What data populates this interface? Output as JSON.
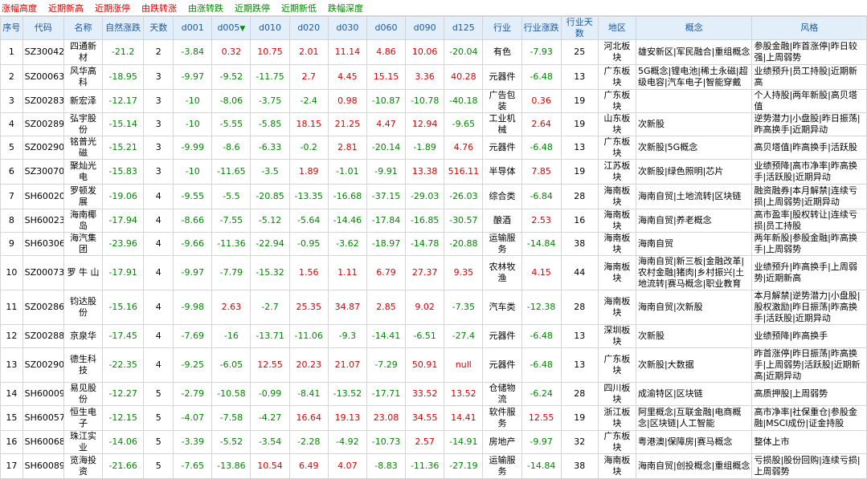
{
  "tabs": [
    {
      "label": "涨幅高度",
      "color": "red"
    },
    {
      "label": "近期新高",
      "color": "red"
    },
    {
      "label": "近期涨停",
      "color": "red"
    },
    {
      "label": "由跌转涨",
      "color": "red"
    },
    {
      "label": "由涨转跌",
      "color": "green"
    },
    {
      "label": "近期跌停",
      "color": "green"
    },
    {
      "label": "近期新低",
      "color": "green"
    },
    {
      "label": "跌幅深度",
      "color": "green"
    }
  ],
  "columns": [
    "序号",
    "代码",
    "名称",
    "自然涨跌",
    "天数",
    "d001",
    "d005",
    "d010",
    "d020",
    "d030",
    "d060",
    "d090",
    "d125",
    "行业",
    "行业涨跌",
    "行业天数",
    "地区",
    "概念",
    "风格"
  ],
  "sort_icon": "down-arrow-icon",
  "rows": [
    [
      "1",
      "SZ300428",
      "四通新材",
      "-21.2",
      "2",
      "-3.84",
      "0.32",
      "10.75",
      "2.01",
      "11.14",
      "4.86",
      "10.06",
      "-20.04",
      "有色",
      "-7.93",
      "25",
      "河北板块",
      "雄安新区|军民融合|重组概念",
      "参股金融|昨首涨停|昨日较强|上周弱势"
    ],
    [
      "2",
      "SZ000636",
      "风华高科",
      "-18.95",
      "3",
      "-9.97",
      "-9.52",
      "-11.75",
      "2.7",
      "4.45",
      "15.15",
      "3.36",
      "40.28",
      "元器件",
      "-6.48",
      "13",
      "广东板块",
      "5G概念|锂电池|稀土永磁|超级电容|汽车电子|智能穿戴",
      "业绩预升|员工持股|近期新高"
    ],
    [
      "3",
      "SZ002836",
      "新宏泽",
      "-12.17",
      "3",
      "-10",
      "-8.06",
      "-3.75",
      "-2.4",
      "0.98",
      "-10.87",
      "-10.78",
      "-40.18",
      "广告包装",
      "0.36",
      "19",
      "广东板块",
      "",
      "个人持股|两年新股|高贝塔值"
    ],
    [
      "4",
      "SZ002890",
      "弘宇股份",
      "-15.14",
      "3",
      "-10",
      "-5.55",
      "-5.85",
      "18.15",
      "21.25",
      "4.47",
      "12.94",
      "-9.65",
      "工业机械",
      "2.64",
      "19",
      "山东板块",
      "次新股",
      "逆势潜力|小盘股|昨日振荡|昨高换手|近期异动"
    ],
    [
      "5",
      "SZ002902",
      "铭普光磁",
      "-15.21",
      "3",
      "-9.99",
      "-8.6",
      "-6.33",
      "-0.2",
      "2.81",
      "-20.14",
      "-1.89",
      "4.76",
      "元器件",
      "-6.48",
      "13",
      "广东板块",
      "次新股|5G概念",
      "高贝塔值|昨高换手|活跃股"
    ],
    [
      "6",
      "SZ300708",
      "聚灿光电",
      "-15.83",
      "3",
      "-10",
      "-11.65",
      "-3.5",
      "1.89",
      "-1.01",
      "-9.91",
      "13.38",
      "516.11",
      "半导体",
      "7.85",
      "19",
      "江苏板块",
      "次新股|绿色照明|芯片",
      "业绩预降|高市净率|昨高换手|活跃股|近期异动"
    ],
    [
      "7",
      "SH600209",
      "罗顿发展",
      "-19.06",
      "4",
      "-9.55",
      "-5.5",
      "-20.85",
      "-13.35",
      "-16.68",
      "-37.15",
      "-29.03",
      "-26.03",
      "综合类",
      "-6.84",
      "28",
      "海南板块",
      "海南自贸|土地流转|区块链",
      "融资融券|本月解禁|连续亏损|上周弱势|近期异动"
    ],
    [
      "8",
      "SH600238",
      "海南椰岛",
      "-17.94",
      "4",
      "-8.66",
      "-7.55",
      "-5.12",
      "-5.64",
      "-14.46",
      "-17.84",
      "-16.85",
      "-30.57",
      "酿酒",
      "2.53",
      "16",
      "海南板块",
      "海南自贸|养老概念",
      "高市盈率|股权转让|连续亏损|员工持股"
    ],
    [
      "9",
      "SH603069",
      "海汽集团",
      "-23.96",
      "4",
      "-9.66",
      "-11.36",
      "-22.94",
      "-0.95",
      "-3.62",
      "-18.97",
      "-14.78",
      "-20.88",
      "运输服务",
      "-14.84",
      "38",
      "海南板块",
      "海南自贸",
      "两年新股|参股金融|昨高换手|上周弱势"
    ],
    [
      "10",
      "SZ000735",
      "罗 牛 山",
      "-17.91",
      "4",
      "-9.97",
      "-7.79",
      "-15.32",
      "1.56",
      "1.11",
      "6.79",
      "27.37",
      "9.35",
      "农林牧渔",
      "4.15",
      "44",
      "海南板块",
      "海南自贸|新三板|金融改革|农村金融|猪肉|乡村振兴|土地流转|赛马概念|职业教育",
      "业绩预升|昨高换手|上周弱势|近期新高"
    ],
    [
      "11",
      "SZ002865",
      "钧达股份",
      "-15.16",
      "4",
      "-9.98",
      "2.63",
      "-2.7",
      "25.35",
      "34.87",
      "2.85",
      "9.02",
      "-7.35",
      "汽车类",
      "-12.38",
      "28",
      "海南板块",
      "海南自贸|次新股",
      "本月解禁|逆势潜力|小盘股|股权激励|昨日振荡|昨高换手|活跃股|近期异动"
    ],
    [
      "12",
      "SZ002885",
      "京泉华",
      "-17.45",
      "4",
      "-7.69",
      "-16",
      "-13.71",
      "-11.06",
      "-9.3",
      "-14.41",
      "-6.51",
      "-27.4",
      "元器件",
      "-6.48",
      "13",
      "深圳板块",
      "次新股",
      "业绩预降|昨高换手"
    ],
    [
      "13",
      "SZ002908",
      "德生科技",
      "-22.35",
      "4",
      "-9.25",
      "-6.05",
      "12.55",
      "20.23",
      "21.07",
      "-7.29",
      "50.91",
      "null",
      "元器件",
      "-6.48",
      "13",
      "广东板块",
      "次新股|大数据",
      "昨首涨停|昨日振荡|昨高换手|上周弱势|活跃股|近期新高|近期异动"
    ],
    [
      "14",
      "SH600093",
      "易见股份",
      "-12.27",
      "5",
      "-2.79",
      "-10.58",
      "-0.99",
      "-8.41",
      "-13.52",
      "-17.71",
      "33.52",
      "13.52",
      "仓储物流",
      "-6.24",
      "28",
      "四川板块",
      "成渝特区|区块链",
      "高质押股|上周弱势"
    ],
    [
      "15",
      "SH600570",
      "恒生电子",
      "-12.15",
      "5",
      "-4.07",
      "-7.58",
      "-4.27",
      "16.64",
      "19.13",
      "23.08",
      "34.55",
      "14.41",
      "软件服务",
      "12.55",
      "19",
      "浙江板块",
      "阿里概念|互联金融|电商概念|区块链|人工智能",
      "高市净率|社保重仓|参股金融|MSCI成份|证金持股"
    ],
    [
      "16",
      "SH600684",
      "珠江实业",
      "-14.06",
      "5",
      "-3.39",
      "-5.52",
      "-3.54",
      "-2.28",
      "-4.92",
      "-10.73",
      "2.57",
      "-14.91",
      "房地产",
      "-9.97",
      "32",
      "广东板块",
      "粤港澳|保障房|赛马概念",
      "整体上市"
    ],
    [
      "17",
      "SH600896",
      "览海投资",
      "-21.66",
      "5",
      "-7.65",
      "-13.86",
      "10.54",
      "6.49",
      "4.07",
      "-8.83",
      "-11.36",
      "-27.19",
      "运输服务",
      "-14.84",
      "38",
      "海南板块",
      "海南自贸|创投概念|重组概念",
      "亏损股|股份回购|连续亏损|上周弱势"
    ]
  ]
}
